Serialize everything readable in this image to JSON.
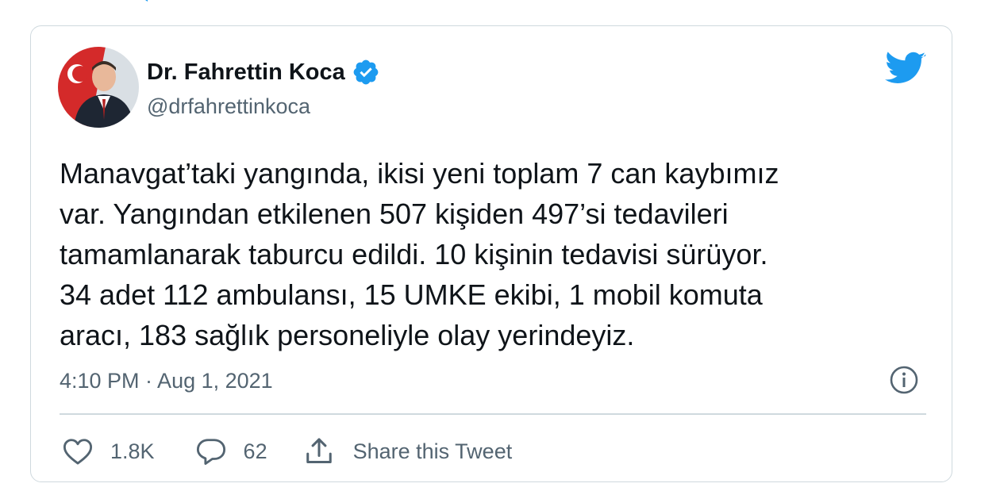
{
  "colors": {
    "twitter_blue": "#1d9bf0",
    "text_primary": "#0f1419",
    "text_secondary": "#536471",
    "border": "#cfd9de"
  },
  "author": {
    "name": "Dr. Fahrettin Koca",
    "handle": "@drfahrettinkoca",
    "verified": true,
    "avatar_icon": "profile-photo"
  },
  "tweet": {
    "lines": [
      "Manavgat’taki yangında, ikisi yeni toplam 7 can kaybımız",
      "var. Yangından etkilenen 507 kişiden 497’si tedavileri",
      "tamamlanarak taburcu edildi. 10 kişinin tedavisi sürüyor.",
      "34 adet 112 ambulansı, 15 UMKE ekibi, 1 mobil komuta",
      "aracı, 183 sağlık personeliyle olay yerindeyiz."
    ],
    "timestamp": "4:10 PM · Aug 1, 2021"
  },
  "actions": {
    "likes": "1.8K",
    "replies": "62",
    "share_label": "Share this Tweet"
  },
  "icons": {
    "logo": "twitter-bird-icon",
    "verified": "verified-badge-icon",
    "info": "info-icon",
    "like": "heart-icon",
    "reply": "speech-bubble-icon",
    "share": "share-upload-icon"
  }
}
